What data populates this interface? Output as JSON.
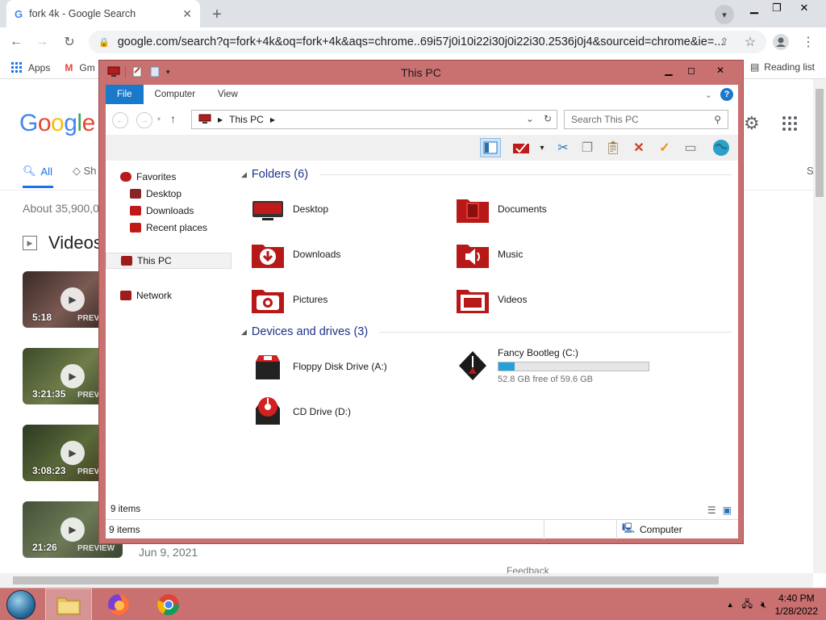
{
  "browser": {
    "tab_title": "fork 4k - Google Search",
    "tab_favicon": "G",
    "url": "google.com/search?q=fork+4k&oq=fork+4k&aqs=chrome..69i57j0i10i22i30j0i22i30.2536j0j4&sourceid=chrome&ie=...",
    "bookmarks": [
      "Apps",
      "Gm"
    ],
    "reading_list": "Reading list"
  },
  "google": {
    "logo_letters": [
      "G",
      "o",
      "o",
      "g",
      "l",
      "e"
    ],
    "tab_all": "All",
    "tab_partial": "Sh",
    "tab_right_partial": "S",
    "about_results": "About 35,900,0",
    "videos_heading": "Videos",
    "videos": [
      {
        "duration": "5:18",
        "preview": "PREVI"
      },
      {
        "duration": "3:21:35",
        "preview": "PREV"
      },
      {
        "duration": "3:08:23",
        "preview": "PREV"
      },
      {
        "duration": "21:26",
        "preview": "PREVIEW"
      }
    ],
    "last_date": "Jun 9, 2021",
    "feedback": "Feedback"
  },
  "explorer": {
    "title": "This PC",
    "ribbon_tabs": [
      "File",
      "Computer",
      "View"
    ],
    "address_crumb": "This PC",
    "search_placeholder": "Search This PC",
    "nav": {
      "favorites": "Favorites",
      "favorites_items": [
        "Desktop",
        "Downloads",
        "Recent places"
      ],
      "this_pc": "This PC",
      "network": "Network"
    },
    "folders_group": "Folders (6)",
    "folders": [
      "Desktop",
      "Documents",
      "Downloads",
      "Music",
      "Pictures",
      "Videos"
    ],
    "devices_group": "Devices and drives (3)",
    "drives": {
      "floppy": "Floppy Disk Drive (A:)",
      "cd": "CD Drive (D:)",
      "c_name": "Fancy Bootleg (C:)",
      "c_free": "52.8 GB free of 59.6 GB",
      "c_used_fraction": 0.11
    },
    "item_count": "9 items",
    "status_count": "9 items",
    "status_location": "Computer",
    "colors": {
      "frame": "#c97070",
      "accent": "#1979ca",
      "group_text": "#1e3287"
    }
  },
  "taskbar": {
    "clock_time": "4:40 PM",
    "clock_date": "1/28/2022"
  }
}
